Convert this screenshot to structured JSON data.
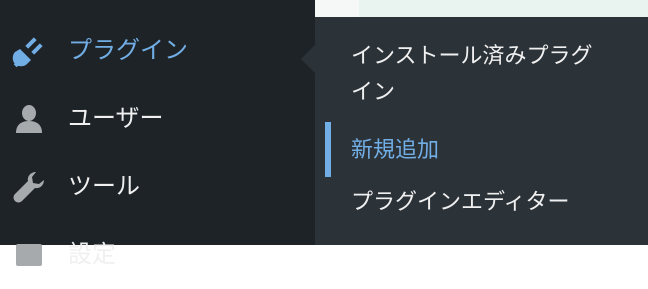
{
  "menu": {
    "items": [
      {
        "label": "プラグイン",
        "icon": "plug-icon",
        "active": true
      },
      {
        "label": "ユーザー",
        "icon": "user-icon"
      },
      {
        "label": "ツール",
        "icon": "wrench-icon"
      },
      {
        "label": "設定",
        "icon": "settings-icon"
      }
    ]
  },
  "submenu": {
    "items": [
      {
        "label": "インストール済みプラグイン"
      },
      {
        "label": "新規追加",
        "current": true
      },
      {
        "label": "プラグインエディター"
      }
    ]
  },
  "colors": {
    "sidebar_bg": "#1d2327",
    "flyout_bg": "#2c3338",
    "accent": "#72aee6",
    "text": "#f0f0f1"
  }
}
